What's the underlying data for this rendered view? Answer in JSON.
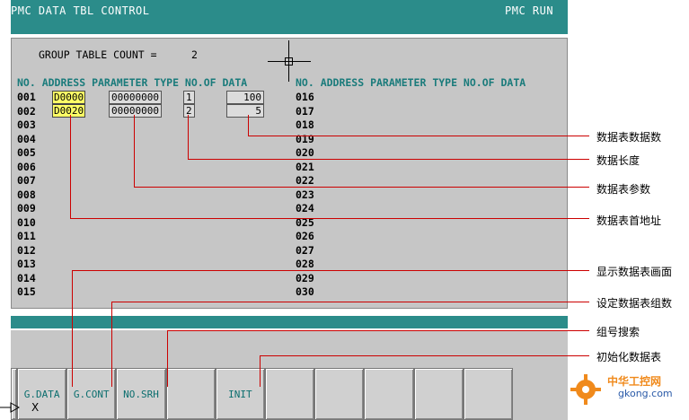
{
  "title": "PMC DATA TBL CONTROL",
  "status": "PMC RUN",
  "group_count_label": "GROUP TABLE COUNT =",
  "group_count_value": "2",
  "headers": {
    "left": "NO. ADDRESS PARAMETER TYPE NO.OF DATA",
    "right": "NO. ADDRESS PARAMETER TYPE NO.OF DATA"
  },
  "left_rows": [
    "001",
    "002",
    "003",
    "004",
    "005",
    "006",
    "007",
    "008",
    "009",
    "010",
    "011",
    "012",
    "013",
    "014",
    "015"
  ],
  "right_rows": [
    "016",
    "017",
    "018",
    "019",
    "020",
    "021",
    "022",
    "023",
    "024",
    "025",
    "026",
    "027",
    "028",
    "029",
    "030"
  ],
  "entries": [
    {
      "address": "D0000",
      "parameter": "00000000",
      "type": "1",
      "count": "100"
    },
    {
      "address": "D0020",
      "parameter": "00000000",
      "type": "2",
      "count": "5"
    }
  ],
  "softkeys": [
    "G.DATA",
    "G.CONT",
    "NO.SRH",
    "",
    "INIT",
    "",
    "",
    "",
    "",
    ""
  ],
  "annotations": {
    "count": "数据表数据数",
    "length": "数据长度",
    "params": "数据表参数",
    "first_addr": "数据表首地址",
    "show": "显示数据表画面",
    "set_groups": "设定数据表组数",
    "group_search": "组号搜索",
    "init": "初始化数据表"
  },
  "watermark": {
    "name": "中华工控网",
    "url": "gkong.com"
  },
  "cursor_label": "X",
  "colors": {
    "teal": "#2b8c8a",
    "panel": "#c6c6c6",
    "highlight": "#ffff66",
    "annot": "#cc0000"
  }
}
